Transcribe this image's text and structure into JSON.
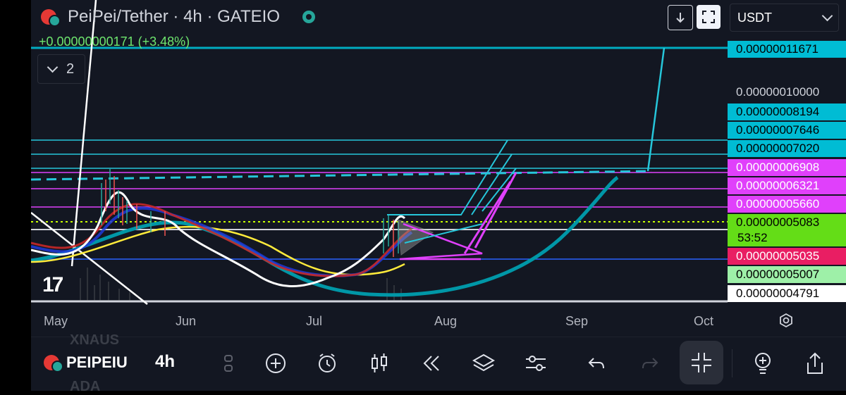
{
  "header": {
    "title": "PeiPei/Tether · 4h · GATEIO",
    "change": "+0.00000000171 (+3.48%)",
    "indicator_count": "2",
    "currency": "USDT",
    "logo": "17"
  },
  "price_scale": [
    {
      "text": "0.00000011671",
      "bg": "#00bcd4",
      "fg": "#000000"
    },
    {
      "text": "0.00000010000",
      "bg": "",
      "fg": "#d1d4dc"
    },
    {
      "text": "0.00000008194",
      "bg": "#00bcd4",
      "fg": "#000000"
    },
    {
      "text": "0.00000007646",
      "bg": "#00bcd4",
      "fg": "#000000"
    },
    {
      "text": "0.00000007020",
      "bg": "#00bcd4",
      "fg": "#000000"
    },
    {
      "text": "0.00000006908",
      "bg": "#e040fb",
      "fg": "#ffffff"
    },
    {
      "text": "0.00000006321",
      "bg": "#e040fb",
      "fg": "#ffffff"
    },
    {
      "text": "0.00000005660",
      "bg": "#e040fb",
      "fg": "#ffffff"
    },
    {
      "text": "0.00000005083",
      "bg": "#64dd17",
      "fg": "#000000"
    },
    {
      "text": "0.00000005035",
      "bg": "#e91e63",
      "fg": "#ffffff"
    },
    {
      "text": "0.00000005007",
      "bg": "#9ef0a8",
      "fg": "#000000"
    },
    {
      "text": "0.00000004791",
      "bg": "#ffffff",
      "fg": "#000000"
    }
  ],
  "countdown": "53:52",
  "time_axis": [
    "May",
    "Jun",
    "Jul",
    "Aug",
    "Sep",
    "Oct"
  ],
  "toolbar": {
    "symbol": "PEIPEIU",
    "interval": "4h",
    "ghost_above": "XNAUS",
    "ghost_below": "ADA",
    "icons": [
      "drag-handle-icon",
      "add-icon",
      "alert-clock-icon",
      "candles-icon",
      "replay-icon",
      "layers-icon",
      "settings-sliders-icon",
      "undo-icon",
      "redo-icon",
      "fullscreen-exit-icon",
      "ideas-icon",
      "share-icon"
    ]
  },
  "colors": {
    "background": "#131722",
    "cyan": "#00bcd4",
    "magenta": "#e040fb",
    "yellow": "#ffeb3b",
    "green": "#64dd17"
  }
}
